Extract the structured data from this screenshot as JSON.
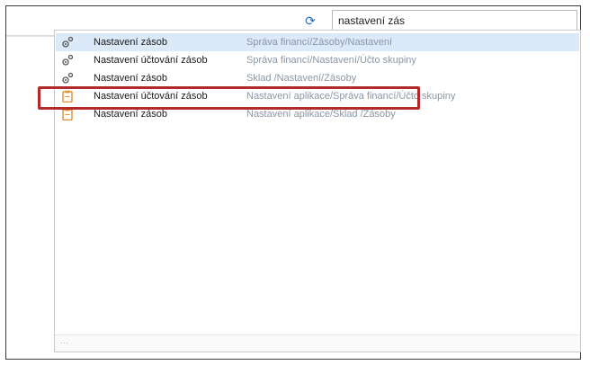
{
  "search": {
    "value": "nastavení zás",
    "refresh_icon": "refresh-icon"
  },
  "results": [
    {
      "name": "Nastavení zásob",
      "path": "Správa financí/Zásoby/Nastavení",
      "icon": "gear-icon",
      "selected": true
    },
    {
      "name": "Nastavení účtování zásob",
      "path": "Správa financí/Nastavení/Účto skupiny",
      "icon": "gear-icon",
      "selected": false
    },
    {
      "name": "Nastavení zásob",
      "path": "Sklad /Nastavení/Zásoby",
      "icon": "gear-icon",
      "selected": false
    },
    {
      "name": "Nastavení účtování zásob",
      "path": "Nastavení aplikace/Správa financí/Účto skupiny",
      "icon": "clipboard-icon",
      "selected": false
    },
    {
      "name": "Nastavení zásob",
      "path": "Nastavení aplikace/Sklad /Zásoby",
      "icon": "clipboard-icon",
      "selected": false
    }
  ],
  "colors": {
    "selected_row": "#dbe9f8",
    "highlight_border": "#b22a2a",
    "path_text": "#8b96a3",
    "accent": "#2a6fc9"
  }
}
